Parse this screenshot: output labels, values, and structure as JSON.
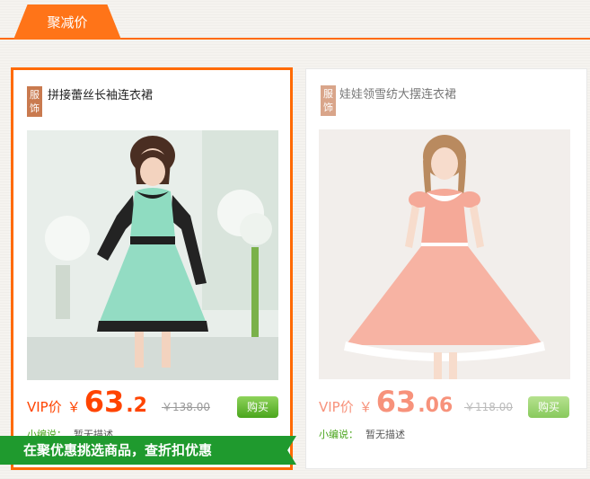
{
  "section": {
    "tab_label": "聚减价"
  },
  "products": [
    {
      "category_tag": "服饰",
      "title": "拼接蕾丝长袖连衣裙",
      "price_label": "VIP价",
      "currency": "￥",
      "price_int": "63",
      "price_dec": ".2",
      "original_price": "￥138.00",
      "buy_label": "购买",
      "editor_label": "小编说：",
      "editor_text": "暂无描述"
    },
    {
      "category_tag": "服饰",
      "title": "娃娃领雪纺大摆连衣裙",
      "price_label": "VIP价",
      "currency": "￥",
      "price_int": "63",
      "price_dec": ".06",
      "original_price": "￥118.00",
      "buy_label": "购买",
      "editor_label": "小编说：",
      "editor_text": "暂无描述"
    }
  ],
  "promo_banner": {
    "text": "在聚优惠挑选商品，查折扣优惠"
  },
  "colors": {
    "accent": "#ff6a00",
    "price": "#ff4400",
    "buy_button": "#4aa51d",
    "banner": "#1f9a2e"
  }
}
